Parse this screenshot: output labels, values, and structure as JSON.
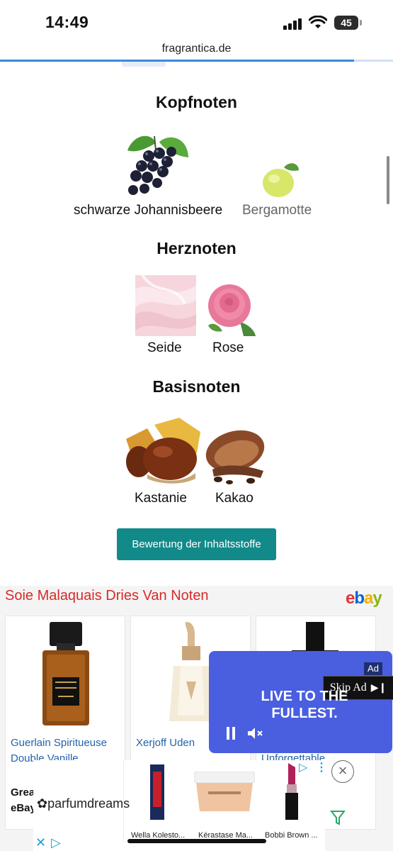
{
  "status_bar": {
    "time": "14:49",
    "battery": "45"
  },
  "browser": {
    "url": "fragrantica.de"
  },
  "notes": {
    "top": {
      "heading": "Kopfnoten",
      "items": [
        {
          "label": "schwarze Johannisbeere",
          "image": "blackcurrant"
        },
        {
          "label": "Bergamotte",
          "image": "bergamot"
        }
      ]
    },
    "heart": {
      "heading": "Herznoten",
      "items": [
        {
          "label": "Seide",
          "image": "silk"
        },
        {
          "label": "Rose",
          "image": "rose"
        }
      ]
    },
    "base": {
      "heading": "Basisnoten",
      "items": [
        {
          "label": "Kastanie",
          "image": "chestnut"
        },
        {
          "label": "Kakao",
          "image": "cocoa"
        }
      ]
    }
  },
  "rating_button": "Bewertung der Inhaltsstoffe",
  "ad": {
    "title": "Soie Malaquais Dries Van Noten",
    "brand_logo": "ebay",
    "cards": [
      {
        "title": "Guerlain Spiritueuse Double Vanille",
        "bold_text": "Grea eBay"
      },
      {
        "title": "Xerjoff Uden"
      },
      {
        "title": "Unforgettable"
      }
    ],
    "video": {
      "badge": "Ad",
      "skip": "Skip Ad",
      "slogan": "LIVE TO THE FULLEST."
    }
  },
  "bottom_banner": {
    "brand": "parfumdreams",
    "products": [
      "Wella Kolesto...",
      "Kérastase Ma...",
      "Bobbi Brown ..."
    ]
  }
}
